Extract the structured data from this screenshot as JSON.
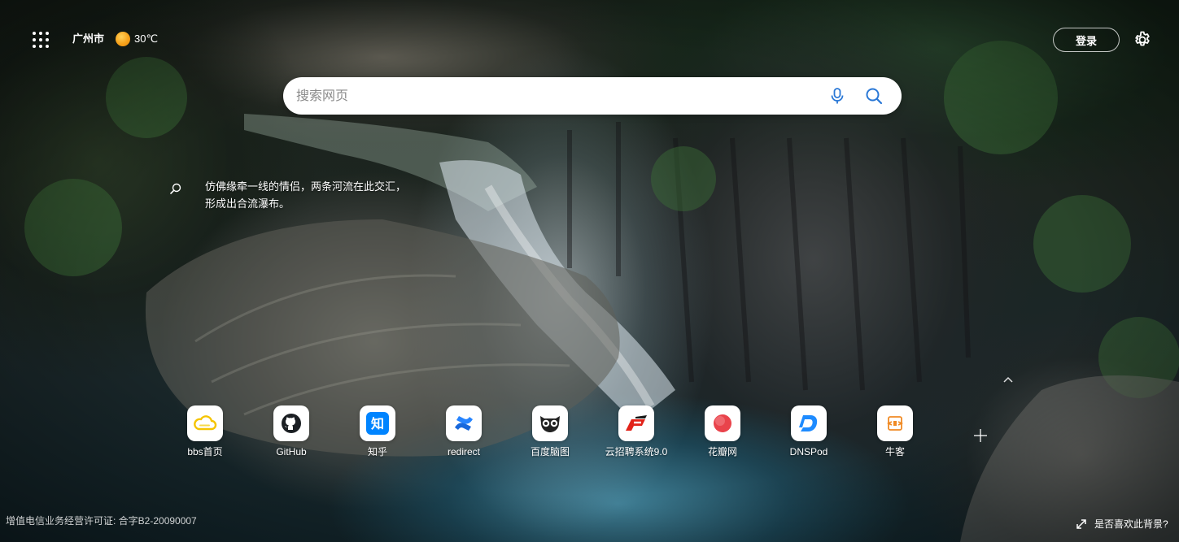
{
  "topbar": {
    "city": "广州市",
    "temperature": "30℃",
    "weather_icon": "sun-icon",
    "login_label": "登录",
    "settings_icon": "gear-icon",
    "apps_icon": "grid-dots-icon"
  },
  "search": {
    "placeholder": "搜索网页",
    "voice_icon": "microphone-icon",
    "search_icon": "search-icon"
  },
  "caption": {
    "text": "仿佛缘牵一线的情侣，两条河流在此交汇，形成出合流瀑布。"
  },
  "shortcuts": [
    {
      "label": "bbs首页",
      "icon": "cloud-logo-icon",
      "color": "#f5c400"
    },
    {
      "label": "GitHub",
      "icon": "github-icon",
      "color": "#1b1f23"
    },
    {
      "label": "知乎",
      "icon": "zhihu-icon",
      "color": "#0084ff"
    },
    {
      "label": "redirect",
      "icon": "confluence-icon",
      "color": "#1868db"
    },
    {
      "label": "百度脑图",
      "icon": "owl-icon",
      "color": "#222222"
    },
    {
      "label": "云招聘系统9.0",
      "icon": "recruit-logo-icon",
      "color": "#e2231a"
    },
    {
      "label": "花瓣网",
      "icon": "huaban-icon",
      "color": "#e9434b"
    },
    {
      "label": "DNSPod",
      "icon": "dnspod-icon",
      "color": "#1e8bff"
    },
    {
      "label": "牛客",
      "icon": "nowcoder-icon",
      "color": "#f08a24"
    }
  ],
  "footer": {
    "license": "增值电信业务经营许可证: 合字B2-20090007",
    "feedback": "是否喜欢此背景?"
  }
}
